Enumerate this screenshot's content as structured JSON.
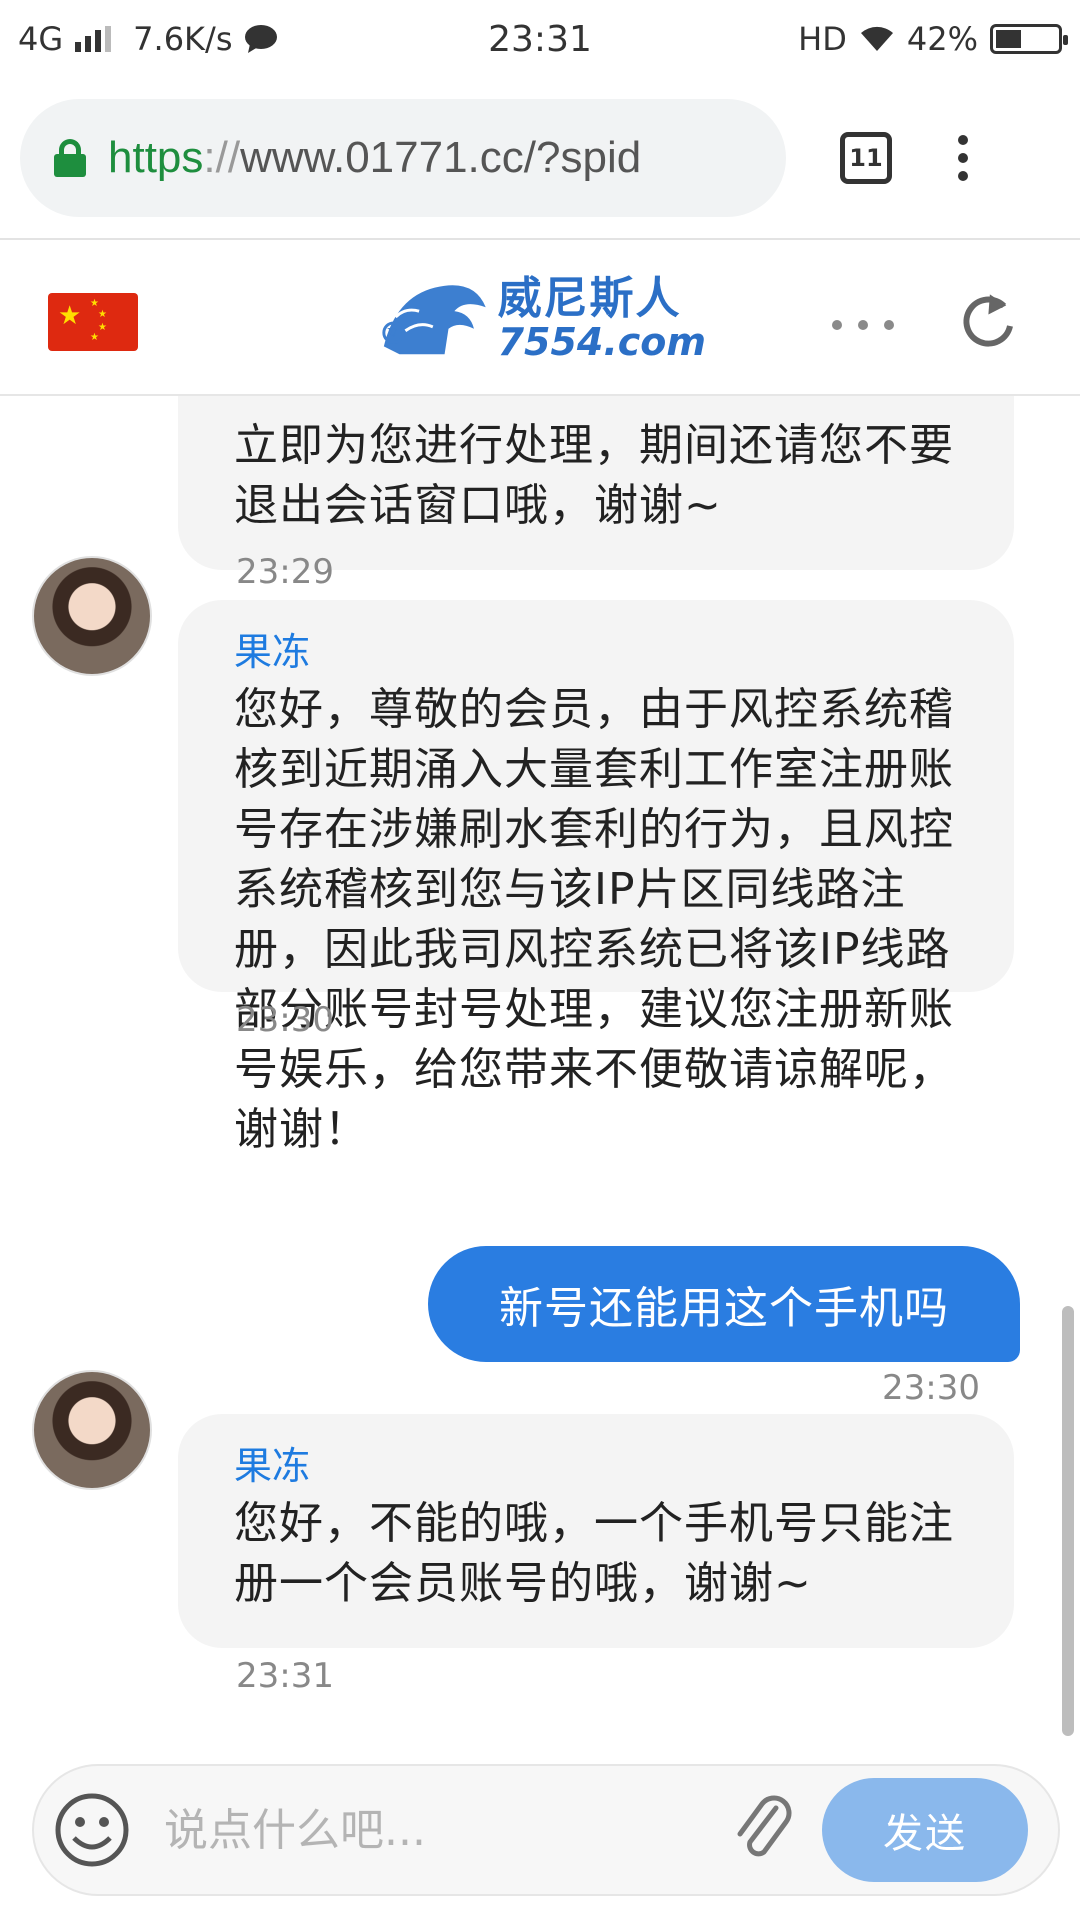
{
  "status_bar": {
    "network": "4G",
    "speed": "7.6K/s",
    "time": "23:31",
    "hd": "HD",
    "battery": "42%",
    "battery_level": 0.42
  },
  "browser": {
    "url_scheme": "https",
    "url_sep": "://",
    "url_rest": "www.01771.cc/?spid",
    "tab_count": "11"
  },
  "site": {
    "logo_cn": "威尼斯人",
    "logo_en": "7554.com"
  },
  "messages": [
    {
      "type": "in",
      "text": "立即为您进行处理，期间还请您不要退出会话窗口哦，谢谢~",
      "time": "23:29"
    },
    {
      "type": "in",
      "sender": "果冻",
      "text": "您好，尊敬的会员，由于风控系统稽核到近期涌入大量套利工作室注册账号存在涉嫌刷水套利的行为，且风控系统稽核到您与该IP片区同线路注册，因此我司风控系统已将该IP线路部分账号封号处理，建议您注册新账号娱乐，给您带来不便敬请谅解呢，谢谢！",
      "time": "23:30"
    },
    {
      "type": "out",
      "text": "新号还能用这个手机吗",
      "time": "23:30"
    },
    {
      "type": "in",
      "sender": "果冻",
      "text": "您好，不能的哦，一个手机号只能注册一个会员账号的哦，谢谢~",
      "time": "23:31"
    }
  ],
  "input": {
    "placeholder": "说点什么吧...",
    "send_label": "发送"
  },
  "colors": {
    "accent": "#2a7de1",
    "sender": "#1e7be0",
    "send_disabled": "#8ab8ec",
    "lock": "#1e8e3e"
  }
}
